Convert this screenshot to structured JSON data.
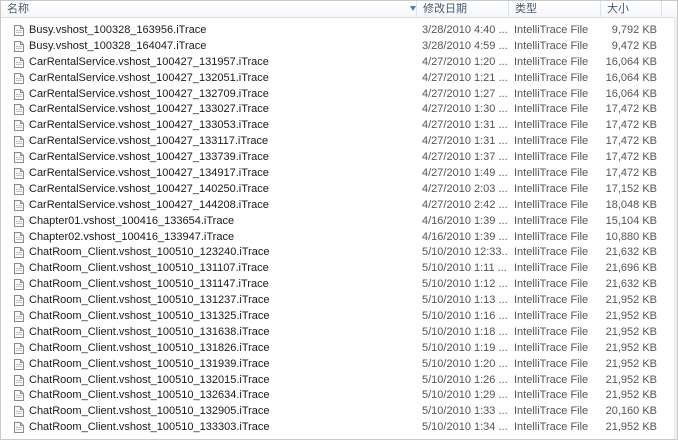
{
  "columns": {
    "name": "名称",
    "modified": "修改日期",
    "type": "类型",
    "size": "大小"
  },
  "icon": "document-icon",
  "files": [
    {
      "name": "Busy.vshost_100328_163956.iTrace",
      "modified": "3/28/2010 4:40 ...",
      "type": "IntelliTrace File",
      "size": "9,792 KB"
    },
    {
      "name": "Busy.vshost_100328_164047.iTrace",
      "modified": "3/28/2010 4:59 ...",
      "type": "IntelliTrace File",
      "size": "9,472 KB"
    },
    {
      "name": "CarRentalService.vshost_100427_131957.iTrace",
      "modified": "4/27/2010 1:20 ...",
      "type": "IntelliTrace File",
      "size": "16,064 KB"
    },
    {
      "name": "CarRentalService.vshost_100427_132051.iTrace",
      "modified": "4/27/2010 1:21 ...",
      "type": "IntelliTrace File",
      "size": "16,064 KB"
    },
    {
      "name": "CarRentalService.vshost_100427_132709.iTrace",
      "modified": "4/27/2010 1:27 ...",
      "type": "IntelliTrace File",
      "size": "16,064 KB"
    },
    {
      "name": "CarRentalService.vshost_100427_133027.iTrace",
      "modified": "4/27/2010 1:30 ...",
      "type": "IntelliTrace File",
      "size": "17,472 KB"
    },
    {
      "name": "CarRentalService.vshost_100427_133053.iTrace",
      "modified": "4/27/2010 1:31 ...",
      "type": "IntelliTrace File",
      "size": "17,472 KB"
    },
    {
      "name": "CarRentalService.vshost_100427_133117.iTrace",
      "modified": "4/27/2010 1:31 ...",
      "type": "IntelliTrace File",
      "size": "17,472 KB"
    },
    {
      "name": "CarRentalService.vshost_100427_133739.iTrace",
      "modified": "4/27/2010 1:37 ...",
      "type": "IntelliTrace File",
      "size": "17,472 KB"
    },
    {
      "name": "CarRentalService.vshost_100427_134917.iTrace",
      "modified": "4/27/2010 1:49 ...",
      "type": "IntelliTrace File",
      "size": "17,472 KB"
    },
    {
      "name": "CarRentalService.vshost_100427_140250.iTrace",
      "modified": "4/27/2010 2:03 ...",
      "type": "IntelliTrace File",
      "size": "17,152 KB"
    },
    {
      "name": "CarRentalService.vshost_100427_144208.iTrace",
      "modified": "4/27/2010 2:42 ...",
      "type": "IntelliTrace File",
      "size": "18,048 KB"
    },
    {
      "name": "Chapter01.vshost_100416_133654.iTrace",
      "modified": "4/16/2010 1:39 ...",
      "type": "IntelliTrace File",
      "size": "15,104 KB"
    },
    {
      "name": "Chapter02.vshost_100416_133947.iTrace",
      "modified": "4/16/2010 1:39 ...",
      "type": "IntelliTrace File",
      "size": "10,880 KB"
    },
    {
      "name": "ChatRoom_Client.vshost_100510_123240.iTrace",
      "modified": "5/10/2010 12:33...",
      "type": "IntelliTrace File",
      "size": "21,632 KB"
    },
    {
      "name": "ChatRoom_Client.vshost_100510_131107.iTrace",
      "modified": "5/10/2010 1:11 ...",
      "type": "IntelliTrace File",
      "size": "21,696 KB"
    },
    {
      "name": "ChatRoom_Client.vshost_100510_131147.iTrace",
      "modified": "5/10/2010 1:12 ...",
      "type": "IntelliTrace File",
      "size": "21,632 KB"
    },
    {
      "name": "ChatRoom_Client.vshost_100510_131237.iTrace",
      "modified": "5/10/2010 1:13 ...",
      "type": "IntelliTrace File",
      "size": "21,952 KB"
    },
    {
      "name": "ChatRoom_Client.vshost_100510_131325.iTrace",
      "modified": "5/10/2010 1:16 ...",
      "type": "IntelliTrace File",
      "size": "21,952 KB"
    },
    {
      "name": "ChatRoom_Client.vshost_100510_131638.iTrace",
      "modified": "5/10/2010 1:18 ...",
      "type": "IntelliTrace File",
      "size": "21,952 KB"
    },
    {
      "name": "ChatRoom_Client.vshost_100510_131826.iTrace",
      "modified": "5/10/2010 1:19 ...",
      "type": "IntelliTrace File",
      "size": "21,952 KB"
    },
    {
      "name": "ChatRoom_Client.vshost_100510_131939.iTrace",
      "modified": "5/10/2010 1:20 ...",
      "type": "IntelliTrace File",
      "size": "21,952 KB"
    },
    {
      "name": "ChatRoom_Client.vshost_100510_132015.iTrace",
      "modified": "5/10/2010 1:26 ...",
      "type": "IntelliTrace File",
      "size": "21,952 KB"
    },
    {
      "name": "ChatRoom_Client.vshost_100510_132634.iTrace",
      "modified": "5/10/2010 1:29 ...",
      "type": "IntelliTrace File",
      "size": "21,952 KB"
    },
    {
      "name": "ChatRoom_Client.vshost_100510_132905.iTrace",
      "modified": "5/10/2010 1:33 ...",
      "type": "IntelliTrace File",
      "size": "20,160 KB"
    },
    {
      "name": "ChatRoom_Client.vshost_100510_133303.iTrace",
      "modified": "5/10/2010 1:34 ...",
      "type": "IntelliTrace File",
      "size": "21,952 KB"
    }
  ]
}
